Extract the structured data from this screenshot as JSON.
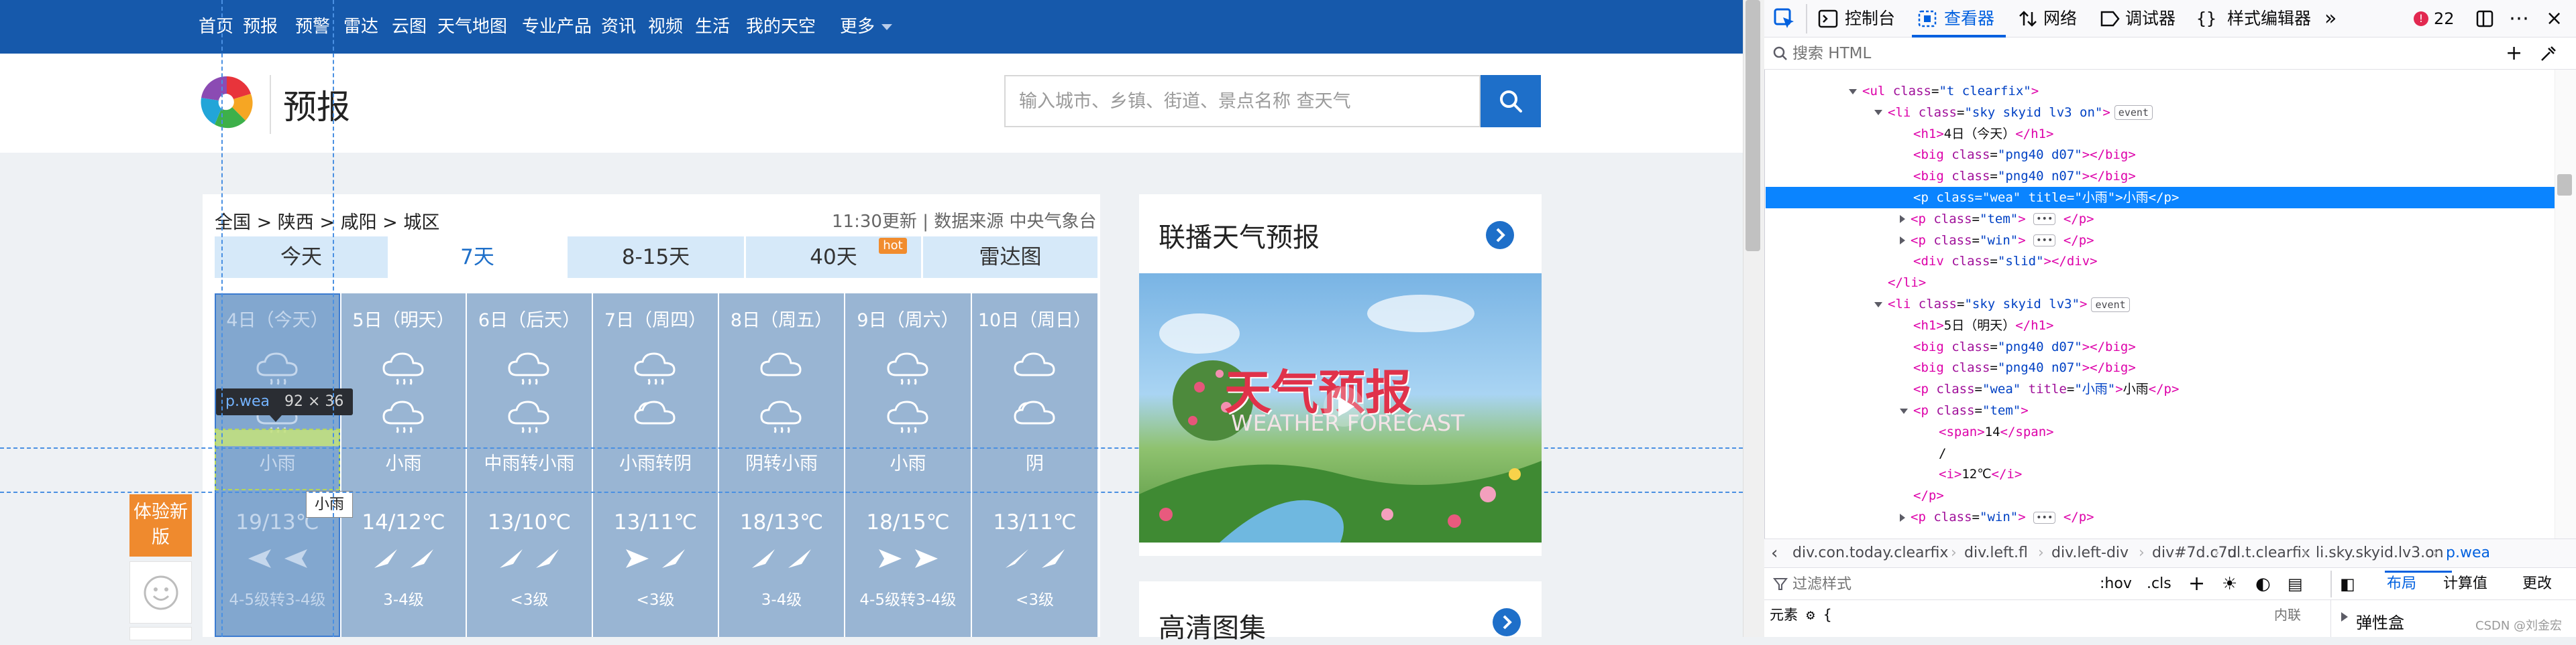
{
  "nav": {
    "items": [
      "首页",
      "预报",
      "预警",
      "雷达",
      "云图",
      "天气地图",
      "专业产品",
      "资讯",
      "视频",
      "生活",
      "我的天空",
      "更多"
    ]
  },
  "brand": {
    "title": "预报"
  },
  "search": {
    "placeholder": "输入城市、乡镇、街道、景点名称 查天气"
  },
  "breadcrumb": "全国 > 陕西 > 咸阳 > 城区",
  "update": "11:30更新 | 数据来源 中央气象台",
  "tabs": [
    "今天",
    "7天",
    "8-15天",
    "40天",
    "雷达图"
  ],
  "hot_badge": "hot",
  "days": [
    {
      "date": "4日（今天）",
      "weather": "小雨",
      "temp": "19/13℃",
      "wind": "4-5级转3-4级"
    },
    {
      "date": "5日（明天）",
      "weather": "小雨",
      "temp": "14/12℃",
      "wind": "3-4级"
    },
    {
      "date": "6日（后天）",
      "weather": "中雨转小雨",
      "temp": "13/10℃",
      "wind": "<3级"
    },
    {
      "date": "7日（周四）",
      "weather": "小雨转阴",
      "temp": "13/11℃",
      "wind": "<3级"
    },
    {
      "date": "8日（周五）",
      "weather": "阴转小雨",
      "temp": "18/13℃",
      "wind": "3-4级"
    },
    {
      "date": "9日（周六）",
      "weather": "小雨",
      "temp": "18/15℃",
      "wind": "4-5级转3-4级"
    },
    {
      "date": "10日（周日）",
      "weather": "阴",
      "temp": "13/11℃",
      "wind": "<3级"
    }
  ],
  "highlight": {
    "tag": "p.wea",
    "dims": "92 × 36",
    "title_tooltip": "小雨"
  },
  "float_buttons": {
    "experience": "体验新版"
  },
  "side": {
    "broadcast_title": "联播天气预报",
    "video_title": "天气预报",
    "video_subtitle": "WEATHER FORECAST",
    "gallery_title": "高清图集"
  },
  "devtools": {
    "tabs": [
      "控制台",
      "查看器",
      "网络",
      "调试器",
      "样式编辑器"
    ],
    "active_tab": "查看器",
    "error_count": "22",
    "search_placeholder": "搜索 HTML",
    "tree": [
      {
        "indent": 0,
        "twisty": "open",
        "html": "<span class='t'>&lt;ul</span> <span class='a'>class</span>=<span class='v'>\"t clearfix\"</span><span class='t'>&gt;</span>"
      },
      {
        "indent": 1,
        "twisty": "open",
        "html": "<span class='t'>&lt;li</span> <span class='a'>class</span>=<span class='v'>\"sky skyid lv3 on\"</span><span class='t'>&gt;</span><span class='badge'>event</span>"
      },
      {
        "indent": 2,
        "twisty": "",
        "html": "<span class='t'>&lt;h1&gt;</span>4日（今天）<span class='t'>&lt;/h1&gt;</span>"
      },
      {
        "indent": 2,
        "twisty": "",
        "html": "<span class='t'>&lt;big</span> <span class='a'>class</span>=<span class='v'>\"png40 d07\"</span><span class='t'>&gt;&lt;/big&gt;</span>"
      },
      {
        "indent": 2,
        "twisty": "",
        "html": "<span class='t'>&lt;big</span> <span class='a'>class</span>=<span class='v'>\"png40 n07\"</span><span class='t'>&gt;&lt;/big&gt;</span>"
      },
      {
        "indent": 2,
        "twisty": "",
        "selected": true,
        "html": "<span class='t'>&lt;p</span> <span class='a'>class</span>=<span class='v'>\"wea\"</span> <span class='a'>title</span>=<span class='v'>\"小雨\"</span><span class='t'>&gt;</span>小雨<span class='t'>&lt;/p&gt;</span>"
      },
      {
        "indent": 2,
        "twisty": "closed",
        "html": "<span class='t'>&lt;p</span> <span class='a'>class</span>=<span class='v'>\"tem\"</span><span class='t'>&gt;</span> <span class='dots'>•••</span> <span class='t'>&lt;/p&gt;</span>"
      },
      {
        "indent": 2,
        "twisty": "closed",
        "html": "<span class='t'>&lt;p</span> <span class='a'>class</span>=<span class='v'>\"win\"</span><span class='t'>&gt;</span> <span class='dots'>•••</span> <span class='t'>&lt;/p&gt;</span>"
      },
      {
        "indent": 2,
        "twisty": "",
        "html": "<span class='t'>&lt;div</span> <span class='a'>class</span>=<span class='v'>\"slid\"</span><span class='t'>&gt;&lt;/div&gt;</span>"
      },
      {
        "indent": 1,
        "twisty": "",
        "html": "<span class='t'>&lt;/li&gt;</span>"
      },
      {
        "indent": 1,
        "twisty": "open",
        "html": "<span class='t'>&lt;li</span> <span class='a'>class</span>=<span class='v'>\"sky skyid lv3\"</span><span class='t'>&gt;</span><span class='badge'>event</span>"
      },
      {
        "indent": 2,
        "twisty": "",
        "html": "<span class='t'>&lt;h1&gt;</span>5日（明天）<span class='t'>&lt;/h1&gt;</span>"
      },
      {
        "indent": 2,
        "twisty": "",
        "html": "<span class='t'>&lt;big</span> <span class='a'>class</span>=<span class='v'>\"png40 d07\"</span><span class='t'>&gt;&lt;/big&gt;</span>"
      },
      {
        "indent": 2,
        "twisty": "",
        "html": "<span class='t'>&lt;big</span> <span class='a'>class</span>=<span class='v'>\"png40 n07\"</span><span class='t'>&gt;&lt;/big&gt;</span>"
      },
      {
        "indent": 2,
        "twisty": "",
        "html": "<span class='t'>&lt;p</span> <span class='a'>class</span>=<span class='v'>\"wea\"</span> <span class='a'>title</span>=<span class='v'>\"小雨\"</span><span class='t'>&gt;</span>小雨<span class='t'>&lt;/p&gt;</span>"
      },
      {
        "indent": 2,
        "twisty": "open",
        "html": "<span class='t'>&lt;p</span> <span class='a'>class</span>=<span class='v'>\"tem\"</span><span class='t'>&gt;</span>"
      },
      {
        "indent": 3,
        "twisty": "",
        "html": "<span class='t'>&lt;span&gt;</span>14<span class='t'>&lt;/span&gt;</span>"
      },
      {
        "indent": 3,
        "twisty": "",
        "html": "/"
      },
      {
        "indent": 3,
        "twisty": "",
        "html": "<span class='t'>&lt;i&gt;</span>12℃<span class='t'>&lt;/i&gt;</span>"
      },
      {
        "indent": 2,
        "twisty": "",
        "html": "<span class='t'>&lt;/p&gt;</span>"
      },
      {
        "indent": 2,
        "twisty": "closed",
        "html": "<span class='t'>&lt;p</span> <span class='a'>class</span>=<span class='v'>\"win\"</span><span class='t'>&gt;</span> <span class='dots'>•••</span> <span class='t'>&lt;/p&gt;</span>"
      }
    ],
    "breadcrumbs": [
      "div.con.today.clearfix",
      "div.left.fl",
      "div.left-div",
      "div#7d.c7d",
      "ul.t.clearfix",
      "li.sky.skyid.lv3.on",
      "p.wea"
    ],
    "filter_placeholder": "过滤样式",
    "hov": ":hov",
    "cls": ".cls",
    "layout_tab": "布局",
    "computed_tab": "计算值",
    "changes_tab": "更改",
    "element_rule": "元素 ⚙ {",
    "inline_label": "内联",
    "flexbox_label": "弹性盒",
    "watermark": "CSDN @刘金宏"
  }
}
